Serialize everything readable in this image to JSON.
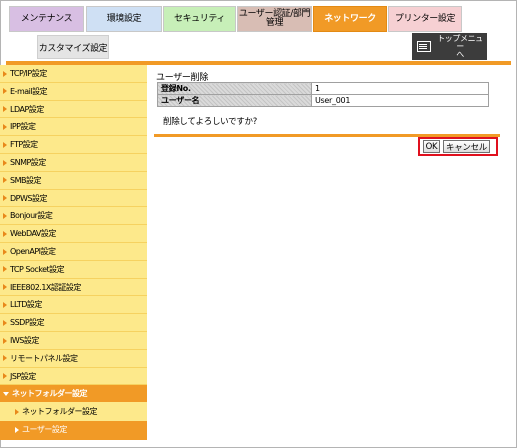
{
  "top_tabs": {
    "maintenance": "メンテナンス",
    "environment": "環境設定",
    "security": "セキュリティ",
    "user_auth_line1": "ユーザー認証/部門",
    "user_auth_line2": "管理",
    "network": "ネットワーク",
    "printer": "プリンター設定"
  },
  "custom_tab": "カスタマイズ設定",
  "top_menu": {
    "line1": "トップメニュー",
    "line2": "へ"
  },
  "sidebar": {
    "items": [
      "TCP/IP設定",
      "E-mail設定",
      "LDAP設定",
      "IPP設定",
      "FTP設定",
      "SNMP設定",
      "SMB設定",
      "DPWS設定",
      "Bonjour設定",
      "WebDAV設定",
      "OpenAPI設定",
      "TCP Socket設定",
      "IEEE802.1X認証設定",
      "LLTD設定",
      "SSDP設定",
      "IWS設定",
      "リモートパネル設定",
      "JSP設定"
    ],
    "expanded": "ネットフォルダー設定",
    "sub_item": "ネットフォルダー設定",
    "active_sub_item": "ユーザー設定"
  },
  "main": {
    "title": "ユーザー削除",
    "rows": [
      {
        "label": "登録No.",
        "value": "1"
      },
      {
        "label": "ユーザー名",
        "value": "User_001"
      }
    ],
    "confirm_text": "削除してよろしいですか?",
    "ok_label": "OK",
    "cancel_label": "キャンセル"
  },
  "colors": {
    "accent_orange": "#f19a26",
    "sidebar_yellow": "#fde98b",
    "highlight_red": "#e0101e"
  }
}
